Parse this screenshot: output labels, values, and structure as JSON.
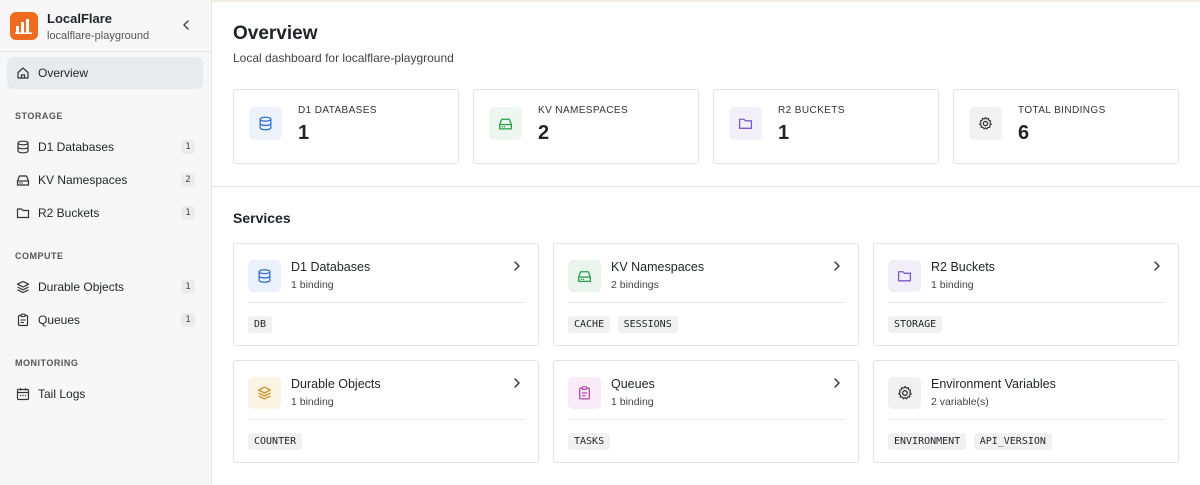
{
  "brand": {
    "name": "LocalFlare",
    "project": "localflare-playground"
  },
  "nav": {
    "overview": "Overview",
    "sections": [
      {
        "label": "STORAGE"
      },
      {
        "label": "COMPUTE"
      },
      {
        "label": "MONITORING"
      }
    ],
    "items": [
      {
        "label": "D1 Databases",
        "count": "1"
      },
      {
        "label": "KV Namespaces",
        "count": "2"
      },
      {
        "label": "R2 Buckets",
        "count": "1"
      },
      {
        "label": "Durable Objects",
        "count": "1"
      },
      {
        "label": "Queues",
        "count": "1"
      },
      {
        "label": "Tail Logs"
      }
    ]
  },
  "header": {
    "title": "Overview",
    "subtitle": "Local dashboard for localflare-playground"
  },
  "stats": [
    {
      "label": "D1 DATABASES",
      "value": "1",
      "icon": "database-icon"
    },
    {
      "label": "KV NAMESPACES",
      "value": "2",
      "icon": "hard-drive-icon"
    },
    {
      "label": "R2 BUCKETS",
      "value": "1",
      "icon": "folder-icon"
    },
    {
      "label": "TOTAL BINDINGS",
      "value": "6",
      "icon": "gear-icon"
    }
  ],
  "services": {
    "title": "Services",
    "cards": [
      {
        "title": "D1 Databases",
        "subtitle": "1 binding",
        "tags": [
          "DB"
        ]
      },
      {
        "title": "KV Namespaces",
        "subtitle": "2 bindings",
        "tags": [
          "CACHE",
          "SESSIONS"
        ]
      },
      {
        "title": "R2 Buckets",
        "subtitle": "1 binding",
        "tags": [
          "STORAGE"
        ]
      },
      {
        "title": "Durable Objects",
        "subtitle": "1 binding",
        "tags": [
          "COUNTER"
        ]
      },
      {
        "title": "Queues",
        "subtitle": "1 binding",
        "tags": [
          "TASKS"
        ]
      },
      {
        "title": "Environment Variables",
        "subtitle": "2 variable(s)",
        "tags": [
          "ENVIRONMENT",
          "API_VERSION"
        ]
      }
    ]
  },
  "colors": {
    "brand": "#f06a1f",
    "d1": "#2f6fd1",
    "kv": "#2a9d4a",
    "r2": "#7a5cc9",
    "durable": "#c9942a",
    "queues": "#b04aa8",
    "neutral": "#444444"
  }
}
